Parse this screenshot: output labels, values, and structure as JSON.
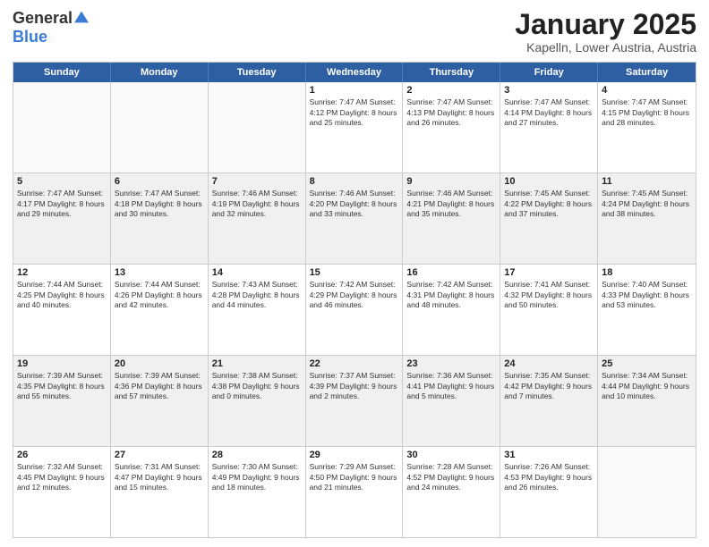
{
  "logo": {
    "general": "General",
    "blue": "Blue"
  },
  "header": {
    "title": "January 2025",
    "subtitle": "Kapelln, Lower Austria, Austria"
  },
  "weekdays": [
    "Sunday",
    "Monday",
    "Tuesday",
    "Wednesday",
    "Thursday",
    "Friday",
    "Saturday"
  ],
  "rows": [
    [
      {
        "day": "",
        "info": ""
      },
      {
        "day": "",
        "info": ""
      },
      {
        "day": "",
        "info": ""
      },
      {
        "day": "1",
        "info": "Sunrise: 7:47 AM\nSunset: 4:12 PM\nDaylight: 8 hours\nand 25 minutes."
      },
      {
        "day": "2",
        "info": "Sunrise: 7:47 AM\nSunset: 4:13 PM\nDaylight: 8 hours\nand 26 minutes."
      },
      {
        "day": "3",
        "info": "Sunrise: 7:47 AM\nSunset: 4:14 PM\nDaylight: 8 hours\nand 27 minutes."
      },
      {
        "day": "4",
        "info": "Sunrise: 7:47 AM\nSunset: 4:15 PM\nDaylight: 8 hours\nand 28 minutes."
      }
    ],
    [
      {
        "day": "5",
        "info": "Sunrise: 7:47 AM\nSunset: 4:17 PM\nDaylight: 8 hours\nand 29 minutes."
      },
      {
        "day": "6",
        "info": "Sunrise: 7:47 AM\nSunset: 4:18 PM\nDaylight: 8 hours\nand 30 minutes."
      },
      {
        "day": "7",
        "info": "Sunrise: 7:46 AM\nSunset: 4:19 PM\nDaylight: 8 hours\nand 32 minutes."
      },
      {
        "day": "8",
        "info": "Sunrise: 7:46 AM\nSunset: 4:20 PM\nDaylight: 8 hours\nand 33 minutes."
      },
      {
        "day": "9",
        "info": "Sunrise: 7:46 AM\nSunset: 4:21 PM\nDaylight: 8 hours\nand 35 minutes."
      },
      {
        "day": "10",
        "info": "Sunrise: 7:45 AM\nSunset: 4:22 PM\nDaylight: 8 hours\nand 37 minutes."
      },
      {
        "day": "11",
        "info": "Sunrise: 7:45 AM\nSunset: 4:24 PM\nDaylight: 8 hours\nand 38 minutes."
      }
    ],
    [
      {
        "day": "12",
        "info": "Sunrise: 7:44 AM\nSunset: 4:25 PM\nDaylight: 8 hours\nand 40 minutes."
      },
      {
        "day": "13",
        "info": "Sunrise: 7:44 AM\nSunset: 4:26 PM\nDaylight: 8 hours\nand 42 minutes."
      },
      {
        "day": "14",
        "info": "Sunrise: 7:43 AM\nSunset: 4:28 PM\nDaylight: 8 hours\nand 44 minutes."
      },
      {
        "day": "15",
        "info": "Sunrise: 7:42 AM\nSunset: 4:29 PM\nDaylight: 8 hours\nand 46 minutes."
      },
      {
        "day": "16",
        "info": "Sunrise: 7:42 AM\nSunset: 4:31 PM\nDaylight: 8 hours\nand 48 minutes."
      },
      {
        "day": "17",
        "info": "Sunrise: 7:41 AM\nSunset: 4:32 PM\nDaylight: 8 hours\nand 50 minutes."
      },
      {
        "day": "18",
        "info": "Sunrise: 7:40 AM\nSunset: 4:33 PM\nDaylight: 8 hours\nand 53 minutes."
      }
    ],
    [
      {
        "day": "19",
        "info": "Sunrise: 7:39 AM\nSunset: 4:35 PM\nDaylight: 8 hours\nand 55 minutes."
      },
      {
        "day": "20",
        "info": "Sunrise: 7:39 AM\nSunset: 4:36 PM\nDaylight: 8 hours\nand 57 minutes."
      },
      {
        "day": "21",
        "info": "Sunrise: 7:38 AM\nSunset: 4:38 PM\nDaylight: 9 hours\nand 0 minutes."
      },
      {
        "day": "22",
        "info": "Sunrise: 7:37 AM\nSunset: 4:39 PM\nDaylight: 9 hours\nand 2 minutes."
      },
      {
        "day": "23",
        "info": "Sunrise: 7:36 AM\nSunset: 4:41 PM\nDaylight: 9 hours\nand 5 minutes."
      },
      {
        "day": "24",
        "info": "Sunrise: 7:35 AM\nSunset: 4:42 PM\nDaylight: 9 hours\nand 7 minutes."
      },
      {
        "day": "25",
        "info": "Sunrise: 7:34 AM\nSunset: 4:44 PM\nDaylight: 9 hours\nand 10 minutes."
      }
    ],
    [
      {
        "day": "26",
        "info": "Sunrise: 7:32 AM\nSunset: 4:45 PM\nDaylight: 9 hours\nand 12 minutes."
      },
      {
        "day": "27",
        "info": "Sunrise: 7:31 AM\nSunset: 4:47 PM\nDaylight: 9 hours\nand 15 minutes."
      },
      {
        "day": "28",
        "info": "Sunrise: 7:30 AM\nSunset: 4:49 PM\nDaylight: 9 hours\nand 18 minutes."
      },
      {
        "day": "29",
        "info": "Sunrise: 7:29 AM\nSunset: 4:50 PM\nDaylight: 9 hours\nand 21 minutes."
      },
      {
        "day": "30",
        "info": "Sunrise: 7:28 AM\nSunset: 4:52 PM\nDaylight: 9 hours\nand 24 minutes."
      },
      {
        "day": "31",
        "info": "Sunrise: 7:26 AM\nSunset: 4:53 PM\nDaylight: 9 hours\nand 26 minutes."
      },
      {
        "day": "",
        "info": ""
      }
    ]
  ]
}
